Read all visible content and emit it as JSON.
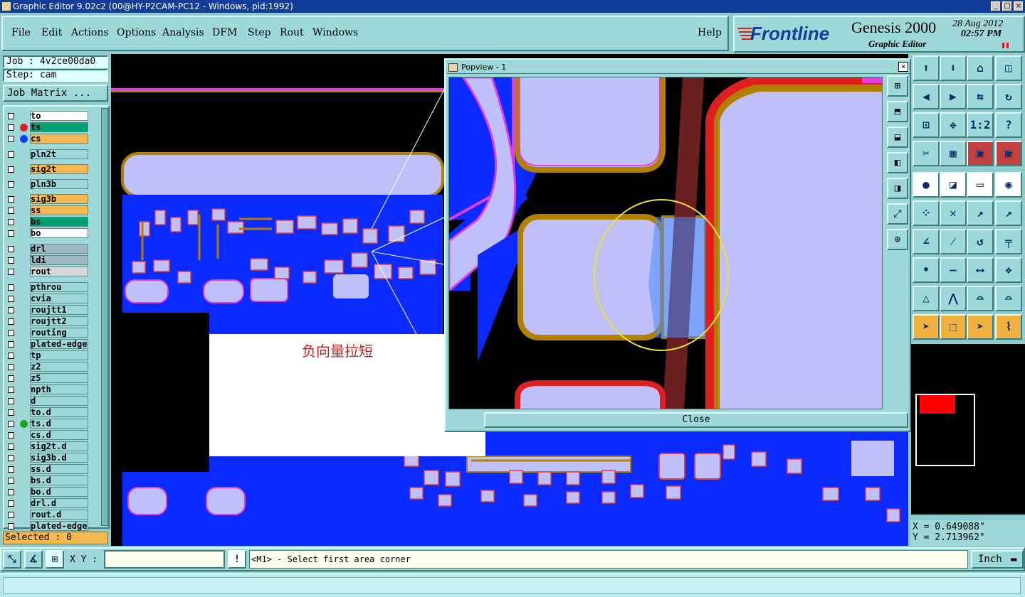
{
  "window": {
    "title": "Graphic Editor 9.02c2 (00@HY-P2CAM-PC12 - Windows, pid:1992)"
  },
  "menu": {
    "file": "File",
    "edit": "Edit",
    "actions": "Actions",
    "options": "Options",
    "analysis": "Analysis",
    "dfm": "DFM",
    "step": "Step",
    "rout": "Rout",
    "windows": "Windows",
    "help": "Help"
  },
  "brand": {
    "logo": "Frontline",
    "product": "Genesis 2000",
    "subtitle": "Graphic Editor",
    "date": "28 Aug 2012",
    "time": "02:57 PM"
  },
  "job": {
    "job_label": "Job : 4v2ce00da0",
    "step_label": "Step: cam",
    "matrix_button": "Job Matrix ..."
  },
  "layers": [
    {
      "name": "to",
      "color": "#ffffff",
      "dot": ""
    },
    {
      "name": "ts",
      "color": "#00a070",
      "dot": "#e02020"
    },
    {
      "name": "cs",
      "color": "#f4b850",
      "dot": "#1040ff"
    },
    {
      "name": "pln2t",
      "color": "#9fd8d8",
      "dot": ""
    },
    {
      "name": "sig2t",
      "color": "#f4b850",
      "dot": ""
    },
    {
      "name": "pln3b",
      "color": "#9fd8d8",
      "dot": ""
    },
    {
      "name": "sig3b",
      "color": "#f4b850",
      "dot": ""
    },
    {
      "name": "ss",
      "color": "#f4b850",
      "dot": ""
    },
    {
      "name": "bs",
      "color": "#00a070",
      "dot": ""
    },
    {
      "name": "bo",
      "color": "#ffffff",
      "dot": ""
    },
    {
      "name": "drl",
      "color": "#a0b8c0",
      "dot": ""
    },
    {
      "name": "ldi",
      "color": "#a0b8c0",
      "dot": ""
    },
    {
      "name": "rout",
      "color": "#d8d8d8",
      "dot": ""
    },
    {
      "name": "pthrou",
      "color": "#9fd8d8",
      "dot": ""
    },
    {
      "name": "cvia",
      "color": "#9fd8d8",
      "dot": ""
    },
    {
      "name": "roujtt1",
      "color": "#9fd8d8",
      "dot": ""
    },
    {
      "name": "roujtt2",
      "color": "#9fd8d8",
      "dot": ""
    },
    {
      "name": "routing",
      "color": "#9fd8d8",
      "dot": ""
    },
    {
      "name": "plated-edge",
      "color": "#9fd8d8",
      "dot": ""
    },
    {
      "name": "tp",
      "color": "#9fd8d8",
      "dot": ""
    },
    {
      "name": "z2",
      "color": "#9fd8d8",
      "dot": ""
    },
    {
      "name": "z5",
      "color": "#9fd8d8",
      "dot": ""
    },
    {
      "name": "npth",
      "color": "#9fd8d8",
      "dot": ""
    },
    {
      "name": "d",
      "color": "#9fd8d8",
      "dot": ""
    },
    {
      "name": "to.d",
      "color": "#9fd8d8",
      "dot": ""
    },
    {
      "name": "ts.d",
      "color": "#9fd8d8",
      "dot": "#20a020"
    },
    {
      "name": "cs.d",
      "color": "#9fd8d8",
      "dot": ""
    },
    {
      "name": "sig2t.d",
      "color": "#9fd8d8",
      "dot": ""
    },
    {
      "name": "sig3b.d",
      "color": "#9fd8d8",
      "dot": ""
    },
    {
      "name": "ss.d",
      "color": "#9fd8d8",
      "dot": ""
    },
    {
      "name": "bs.d",
      "color": "#9fd8d8",
      "dot": ""
    },
    {
      "name": "bo.d",
      "color": "#9fd8d8",
      "dot": ""
    },
    {
      "name": "drl.d",
      "color": "#9fd8d8",
      "dot": ""
    },
    {
      "name": "rout.d",
      "color": "#9fd8d8",
      "dot": ""
    },
    {
      "name": "plated-edge",
      "color": "#9fd8d8",
      "dot": ""
    }
  ],
  "selected": {
    "label": "Selected : 0"
  },
  "popview": {
    "title": "Popview - 1",
    "close": "Close"
  },
  "annotation": {
    "text": "负向量拉短"
  },
  "tools": {
    "ratio": "1:2",
    "help": "?"
  },
  "coords": {
    "x": "X = 0.649088\"",
    "y": "Y = 2.713962\""
  },
  "status": {
    "xy_label": "X Y :",
    "xy_value": "",
    "message": "<M1> - Select first area corner",
    "unit": "Inch"
  }
}
